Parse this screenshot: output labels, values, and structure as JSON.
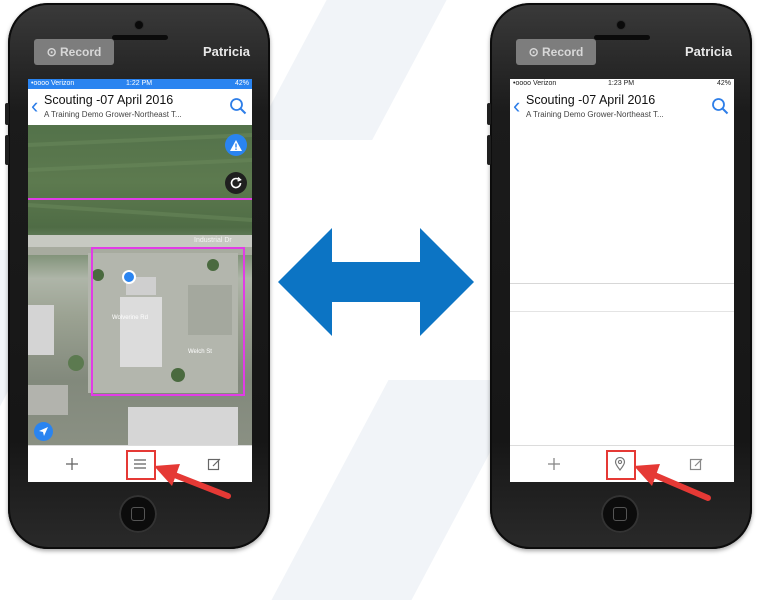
{
  "left_phone": {
    "record_label": "Record",
    "user_name": "Patricia",
    "status": {
      "carrier": "•oooo Verizon",
      "time": "1:22 PM",
      "battery": "42%"
    },
    "header": {
      "title": "Scouting -07 April 2016",
      "subtitle": "A Training Demo Grower-Northeast T..."
    },
    "map_labels": {
      "road": "Industrial Dr",
      "building": "Wolverine Rd",
      "street": "Welch St"
    },
    "tabbar": [
      "add-icon",
      "list-icon",
      "edit-icon"
    ],
    "highlighted_tab": "list-icon"
  },
  "right_phone": {
    "record_label": "Record",
    "user_name": "Patricia",
    "status": {
      "carrier": "•oooo Verizon",
      "time": "1:23 PM",
      "battery": "42%"
    },
    "header": {
      "title": "Scouting -07 April 2016",
      "subtitle": "A Training Demo Grower-Northeast T..."
    },
    "tabbar": [
      "add-icon",
      "map-pin-icon",
      "edit-icon"
    ],
    "highlighted_tab": "map-pin-icon"
  },
  "colors": {
    "accent_blue": "#2a84f0",
    "swap_arrow": "#0c74c4",
    "highlight_red": "#e53935",
    "boundary_magenta": "#e13ce6"
  },
  "icons": {
    "center_arrow": "double-headed-arrow-icon"
  }
}
